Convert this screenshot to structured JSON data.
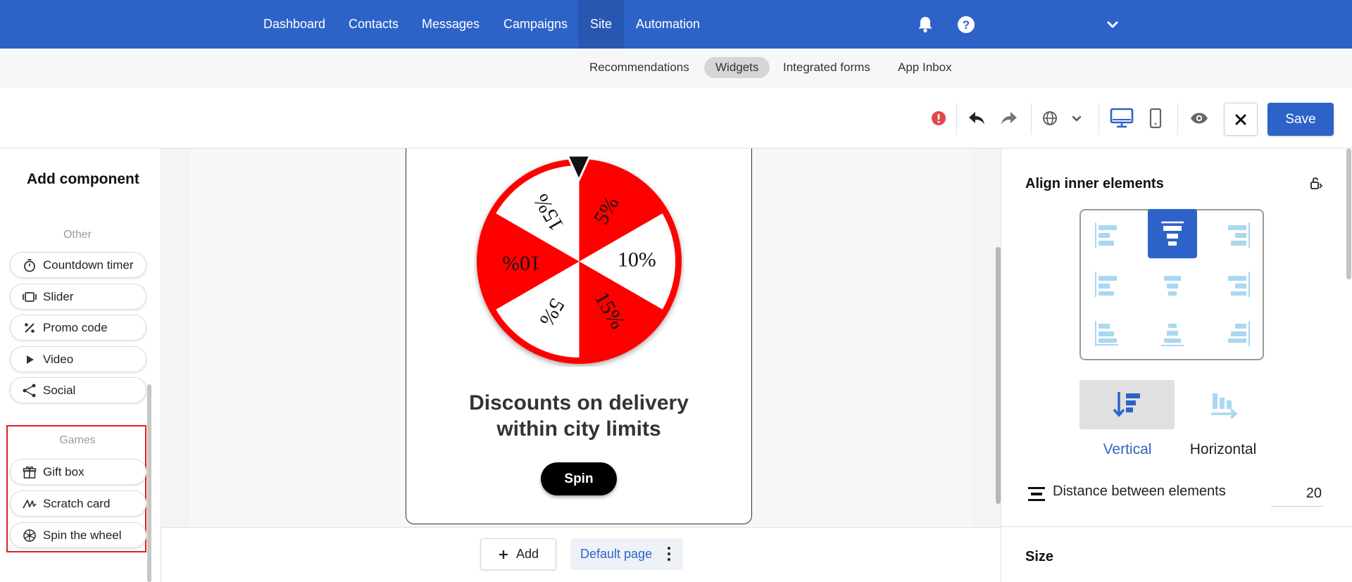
{
  "topnav": {
    "items": [
      {
        "label": "Dashboard"
      },
      {
        "label": "Contacts"
      },
      {
        "label": "Messages"
      },
      {
        "label": "Campaigns"
      },
      {
        "label": "Site",
        "active": true
      },
      {
        "label": "Automation"
      }
    ],
    "icons": [
      "bell-icon",
      "help-icon",
      "chevron-down-icon"
    ]
  },
  "subnav": {
    "items": [
      {
        "label": "Recommendations"
      },
      {
        "label": "Widgets",
        "active": true
      },
      {
        "label": "Integrated forms"
      },
      {
        "label": "App Inbox"
      }
    ]
  },
  "toolbar": {
    "icons": [
      "error-icon",
      "undo-icon",
      "redo-icon",
      "globe-icon",
      "chevron-down-icon",
      "desktop-icon",
      "mobile-icon",
      "preview-eye-icon",
      "close-icon"
    ],
    "save_label": "Save"
  },
  "left_panel": {
    "title": "Add component",
    "other_label": "Other",
    "other_items": [
      {
        "label": "Countdown timer",
        "icon": "timer-icon"
      },
      {
        "label": "Slider",
        "icon": "slider-icon"
      },
      {
        "label": "Promo code",
        "icon": "percent-icon"
      },
      {
        "label": "Video",
        "icon": "play-icon"
      },
      {
        "label": "Social",
        "icon": "share-icon"
      }
    ],
    "games_label": "Games",
    "games_items": [
      {
        "label": "Gift box",
        "icon": "gift-icon"
      },
      {
        "label": "Scratch card",
        "icon": "scratch-icon"
      },
      {
        "label": "Spin the wheel",
        "icon": "wheel-icon"
      }
    ]
  },
  "widget": {
    "wheel_segments": [
      "5%",
      "10%",
      "15%",
      "5%",
      "10%",
      "15%"
    ],
    "wheel_colors": [
      "#ff0000",
      "#ffffff"
    ],
    "headline_line1": "Discounts on delivery",
    "headline_line2": "within city limits",
    "spin_label": "Spin"
  },
  "bottom_bar": {
    "add_label": "Add",
    "page_label": "Default page"
  },
  "right_panel": {
    "align_title": "Align inner elements",
    "direction_vertical": "Vertical",
    "direction_horizontal": "Horizontal",
    "distance_label": "Distance between elements",
    "distance_value": "20",
    "size_title": "Size"
  },
  "colors": {
    "accent": "#2d63c8",
    "games_highlight": "#e02020",
    "align_icon_light": "#a9d8f0"
  }
}
